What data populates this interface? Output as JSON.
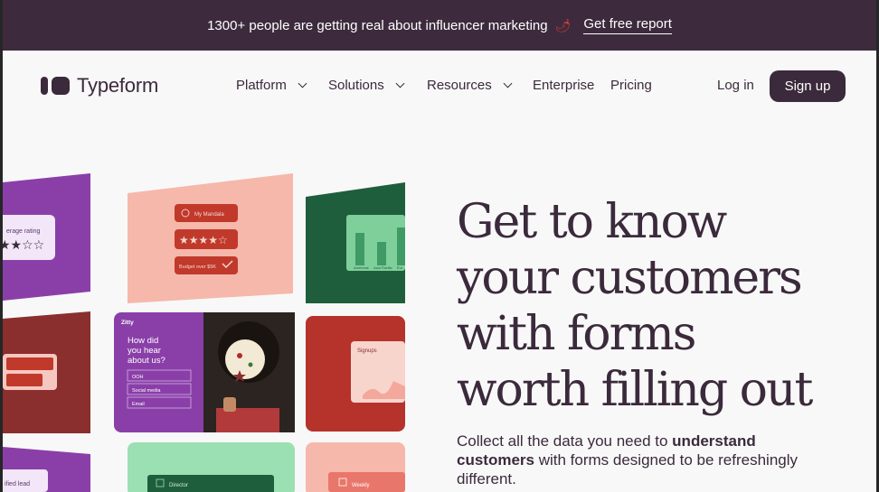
{
  "banner": {
    "text": "1300+ people are getting real about influencer marketing",
    "emoji": "🌶",
    "link": "Get free report"
  },
  "nav": {
    "logo": "Typeform",
    "items": [
      {
        "label": "Platform",
        "dropdown": true
      },
      {
        "label": "Solutions",
        "dropdown": true
      },
      {
        "label": "Resources",
        "dropdown": true
      },
      {
        "label": "Enterprise",
        "dropdown": false
      },
      {
        "label": "Pricing",
        "dropdown": false
      }
    ],
    "login": "Log in",
    "signup": "Sign up"
  },
  "hero": {
    "headline": [
      "Get to know",
      "your customers",
      "with forms",
      "worth filling out"
    ],
    "sub_parts": [
      "Collect all the data you need to ",
      "understand customers",
      " with forms designed to be refreshingly different."
    ]
  },
  "collage": {
    "rating_label": "erage rating",
    "form1_name": "My Mandala",
    "form1_budget": "Budget over $5K",
    "chart_labels": [
      "Americas",
      "Asia Pacific",
      "Eur"
    ],
    "brand": "Zitty",
    "question": "How did you hear about us?",
    "options": [
      "OOH",
      "Social media",
      "Email"
    ],
    "signups_label": "Signups",
    "lead_label": "ified lead",
    "director_label": "Director",
    "weekly_label": "Weekly"
  },
  "colors": {
    "banner_bg": "#3d2b3d",
    "brand_dark": "#3b2a3b",
    "page_bg": "#f8f8f9"
  }
}
